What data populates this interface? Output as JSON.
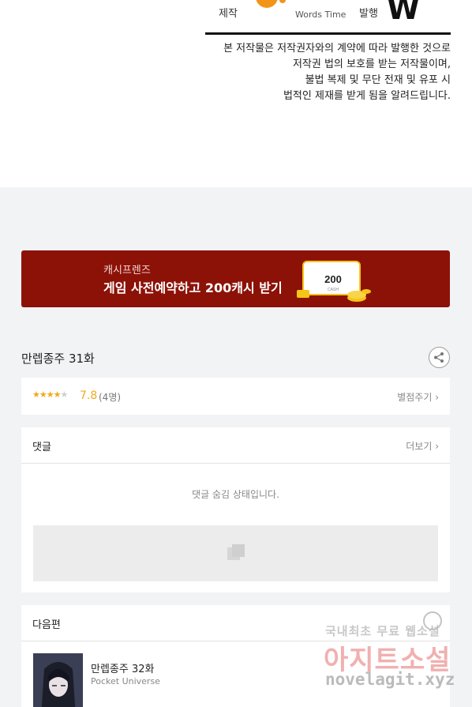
{
  "credits": {
    "production_label": "제작",
    "production_brand": "Words Time",
    "publisher_label": "발행",
    "publisher_mark": "W"
  },
  "notice": {
    "lines": [
      "본 저작물은 저작권자와의 계약에 따라 발행한 것으로",
      "저작권 법의 보호를 받는 저작물이며,",
      "불법 복제 및 무단 전재 및 유포 시",
      "법적인 제재를 받게 됨을 알려드립니다."
    ]
  },
  "banner": {
    "subtitle": "캐시프렌즈",
    "title": "게임 사전예약하고 200캐시 받기",
    "amount": "200",
    "unit": "CASH",
    "bg_color": "#8c1208"
  },
  "episode": {
    "title": "만렙종주 31화",
    "share_icon": "share-icon"
  },
  "rating": {
    "stars_on": "★★★★",
    "stars_off": "★",
    "score": "7.8",
    "count": "(4명)",
    "rate_link": "별점주기 ›",
    "star_color": "#f0a91a"
  },
  "comments": {
    "title": "댓글",
    "more": "더보기 ›",
    "hidden_message": "댓글 숨김 상태입니다."
  },
  "next": {
    "title": "다음편",
    "episode_title": "만렙종주 32화",
    "publisher": "Pocket Universe"
  },
  "watermark": {
    "top": "국내최초 무료 웹소설",
    "main": "아지트소설",
    "url": "novelagit.xyz"
  }
}
